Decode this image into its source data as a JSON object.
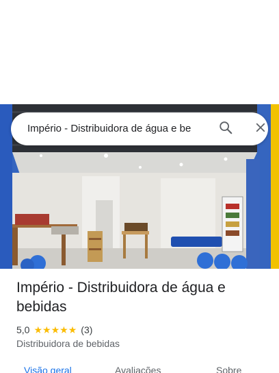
{
  "search": {
    "query": "Império - Distribuidora de água e be",
    "search_icon": "search-icon",
    "close_icon": "close-icon"
  },
  "place": {
    "title": "Império - Distribuidora de água e bebidas",
    "rating": "5,0",
    "stars": 5,
    "review_count": "(3)",
    "category": "Distribuidora de bebidas"
  },
  "tabs": [
    {
      "label": "Visão geral",
      "active": true
    },
    {
      "label": "Avaliações",
      "active": false
    },
    {
      "label": "Sobre",
      "active": false
    }
  ],
  "colors": {
    "accent": "#1a73e8",
    "star": "#fbbc04",
    "text": "#202124"
  }
}
